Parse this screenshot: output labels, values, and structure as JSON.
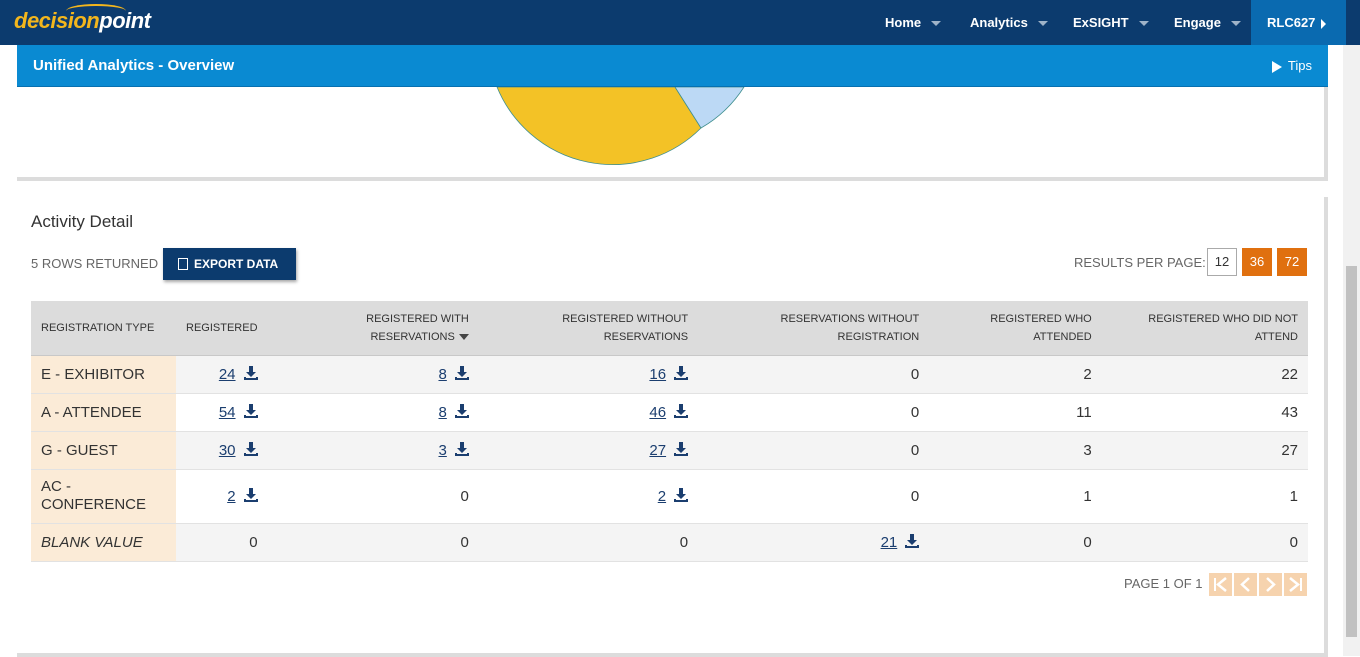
{
  "brand": {
    "logo_part1": "decision",
    "logo_part2": "point"
  },
  "nav": {
    "items": [
      {
        "label": "Home"
      },
      {
        "label": "Analytics"
      },
      {
        "label": "ExSIGHT"
      },
      {
        "label": "Engage"
      }
    ],
    "user": "RLC627"
  },
  "subheader": {
    "title": "Unified Analytics - Overview",
    "tips": "Tips"
  },
  "activity": {
    "title": "Activity Detail",
    "rows_returned": "5 ROWS RETURNED",
    "export_label": "EXPORT DATA",
    "results_per_page_label": "RESULTS PER PAGE:",
    "results_per_page_options": [
      "12",
      "36",
      "72"
    ],
    "page_label": "PAGE 1 OF 1"
  },
  "table": {
    "headers": {
      "type": "REGISTRATION TYPE",
      "registered": "REGISTERED",
      "with_res_1": "REGISTERED WITH",
      "with_res_2": "RESERVATIONS",
      "without_res_1": "REGISTERED WITHOUT",
      "without_res_2": "RESERVATIONS",
      "res_without_reg_1": "RESERVATIONS WITHOUT",
      "res_without_reg_2": "REGISTRATION",
      "attended_1": "REGISTERED WHO",
      "attended_2": "ATTENDED",
      "not_attend_1": "REGISTERED WHO DID NOT",
      "not_attend_2": "ATTEND"
    },
    "rows": [
      {
        "type": "E - EXHIBITOR",
        "registered": "24",
        "with_res": "8",
        "without_res": "16",
        "res_without_reg": "0",
        "attended": "2",
        "not_attend": "22"
      },
      {
        "type": "A - ATTENDEE",
        "registered": "54",
        "with_res": "8",
        "without_res": "46",
        "res_without_reg": "0",
        "attended": "11",
        "not_attend": "43"
      },
      {
        "type": "G - GUEST",
        "registered": "30",
        "with_res": "3",
        "without_res": "27",
        "res_without_reg": "0",
        "attended": "3",
        "not_attend": "27"
      },
      {
        "type": "AC - CONFERENCE",
        "registered": "2",
        "with_res": "0",
        "without_res": "2",
        "res_without_reg": "0",
        "attended": "1",
        "not_attend": "1"
      },
      {
        "type": "BLANK VALUE",
        "registered": "0",
        "with_res": "0",
        "without_res": "0",
        "res_without_reg": "21",
        "attended": "0",
        "not_attend": "0"
      }
    ]
  },
  "colors": {
    "nav_bg": "#0c3b6e",
    "subheader_bg": "#0a8ad2",
    "accent_orange": "#e0700f",
    "pie_yellow": "#f3c226",
    "pie_light_blue": "#bcd9f5"
  }
}
